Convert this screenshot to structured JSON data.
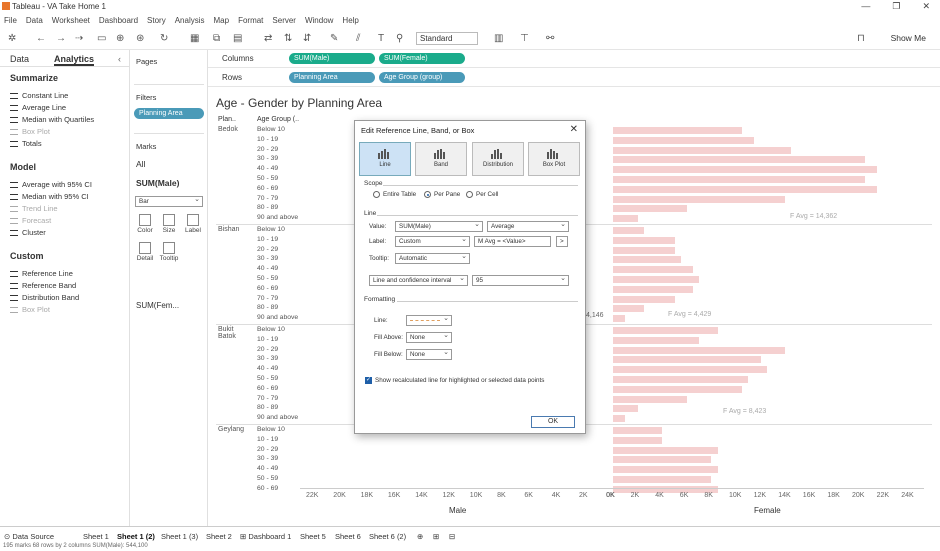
{
  "window": {
    "title": "Tableau - VA Take Home 1"
  },
  "menu": [
    "File",
    "Data",
    "Worksheet",
    "Dashboard",
    "Story",
    "Analysis",
    "Map",
    "Format",
    "Server",
    "Window",
    "Help"
  ],
  "toolbar": {
    "fit": "Standard",
    "show_me": "Show Me"
  },
  "left": {
    "tab_data": "Data",
    "tab_analytics": "Analytics",
    "summarize_title": "Summarize",
    "summarize": [
      {
        "label": "Constant Line",
        "enabled": true
      },
      {
        "label": "Average Line",
        "enabled": true
      },
      {
        "label": "Median with Quartiles",
        "enabled": true
      },
      {
        "label": "Box Plot",
        "enabled": false
      },
      {
        "label": "Totals",
        "enabled": true
      }
    ],
    "model_title": "Model",
    "model": [
      {
        "label": "Average with 95% CI",
        "enabled": true
      },
      {
        "label": "Median with 95% CI",
        "enabled": true
      },
      {
        "label": "Trend Line",
        "enabled": false
      },
      {
        "label": "Forecast",
        "enabled": false
      },
      {
        "label": "Cluster",
        "enabled": true
      }
    ],
    "custom_title": "Custom",
    "custom": [
      {
        "label": "Reference Line",
        "enabled": true
      },
      {
        "label": "Reference Band",
        "enabled": true
      },
      {
        "label": "Distribution Band",
        "enabled": true
      },
      {
        "label": "Box Plot",
        "enabled": false
      }
    ]
  },
  "cards": {
    "pages": "Pages",
    "filters": "Filters",
    "filter_pill": "Planning Area",
    "marks": "Marks",
    "all": "All",
    "sum_male": "SUM(Male)",
    "mark_type": "Bar",
    "color": "Color",
    "size": "Size",
    "label": "Label",
    "detail": "Detail",
    "tooltip": "Tooltip",
    "sum_female": "SUM(Fem..."
  },
  "shelves": {
    "columns_label": "Columns",
    "columns": [
      "SUM(Male)",
      "SUM(Female)"
    ],
    "rows_label": "Rows",
    "rows": [
      "Planning Area",
      "Age Group (group)"
    ]
  },
  "viz": {
    "title": "Age - Gender by Planning Area",
    "hdr_plan": "Plan..",
    "hdr_age": "Age Group (..",
    "areas": [
      {
        "name": "Bedok",
        "ages": [
          "Below 10",
          "10 - 19",
          "20 - 29",
          "30 - 39",
          "40 - 49",
          "50 - 59",
          "60 - 69",
          "70 - 79",
          "80 - 89",
          "90 and above"
        ]
      },
      {
        "name": "Bishan",
        "ages": [
          "Below 10",
          "10 - 19",
          "20 - 29",
          "30 - 39",
          "40 - 49",
          "50 - 59",
          "60 - 69",
          "70 - 79",
          "80 - 89",
          "90 and above"
        ]
      },
      {
        "name": "Bukit Batok",
        "ages": [
          "Below 10",
          "10 - 19",
          "20 - 29",
          "30 - 39",
          "40 - 49",
          "50 - 59",
          "60 - 69",
          "70 - 79",
          "80 - 89",
          "90 and above"
        ]
      },
      {
        "name": "Geylang",
        "ages": [
          "Below 10",
          "10 - 19",
          "20 - 29",
          "30 - 39",
          "40 - 49",
          "50 - 59",
          "60 - 69"
        ]
      }
    ],
    "annotations": {
      "bedok": "F Avg = 14,362",
      "bishan": "F Avg = 4,429",
      "bukit": "F Avg = 8,423",
      "male_partial": "4,146"
    },
    "male_ticks": [
      "22K",
      "20K",
      "18K",
      "16K",
      "14K",
      "12K",
      "10K",
      "8K",
      "6K",
      "4K",
      "2K",
      "0K"
    ],
    "female_ticks": [
      "0K",
      "2K",
      "4K",
      "6K",
      "8K",
      "10K",
      "12K",
      "14K",
      "16K",
      "18K",
      "20K",
      "22K",
      "24K"
    ],
    "male_label": "Male",
    "female_label": "Female"
  },
  "dialog": {
    "title": "Edit Reference Line, Band, or Box",
    "tabs": [
      "Line",
      "Band",
      "Distribution",
      "Box Plot"
    ],
    "scope_title": "Scope",
    "scope": [
      "Entire Table",
      "Per Pane",
      "Per Cell"
    ],
    "line_title": "Line",
    "value_label": "Value:",
    "value": "SUM(Male)",
    "aggregation": "Average",
    "label_label": "Label:",
    "label_type": "Custom",
    "label_text": "M Avg = <Value>",
    "label_insert": ">",
    "tooltip_label": "Tooltip:",
    "tooltip_value": "Automatic",
    "interval": "Line and confidence interval",
    "confidence": "95",
    "formatting_title": "Formatting",
    "line_fmt": "Line:",
    "fill_above": "Fill Above:",
    "fill_above_value": "None",
    "fill_below": "Fill Below:",
    "fill_below_value": "None",
    "recalc": "Show recalculated line for highlighted or selected data points",
    "ok": "OK"
  },
  "sheets": [
    "Data Source",
    "Sheet 1",
    "Sheet 1 (2)",
    "Sheet 1 (3)",
    "Sheet 2",
    "Dashboard 1",
    "Sheet 5",
    "Sheet 6",
    "Sheet 6 (2)"
  ],
  "status": "195 marks   68 rows by 2 columns   SUM(Male): 544,100",
  "chart_data": {
    "type": "bar",
    "title": "Age - Gender by Planning Area",
    "xlabel_left": "Male",
    "xlabel_right": "Female",
    "categories": [
      "Bedok",
      "Bishan",
      "Bukit Batok",
      "Geylang"
    ],
    "female_values_k": {
      "Bedok": [
        10.5,
        11.5,
        14.5,
        20.5,
        21.5,
        20.5,
        21.5,
        14,
        6,
        2
      ],
      "Bishan": [
        2.5,
        5,
        5,
        5.5,
        6.5,
        7,
        6.5,
        5,
        2.5,
        1
      ],
      "Bukit Batok": [
        8.5,
        7,
        14,
        12,
        12.5,
        11,
        10.5,
        6,
        2,
        1
      ],
      "Geylang": [
        4,
        4,
        8.5,
        8,
        8.5,
        8,
        8.5
      ]
    }
  }
}
